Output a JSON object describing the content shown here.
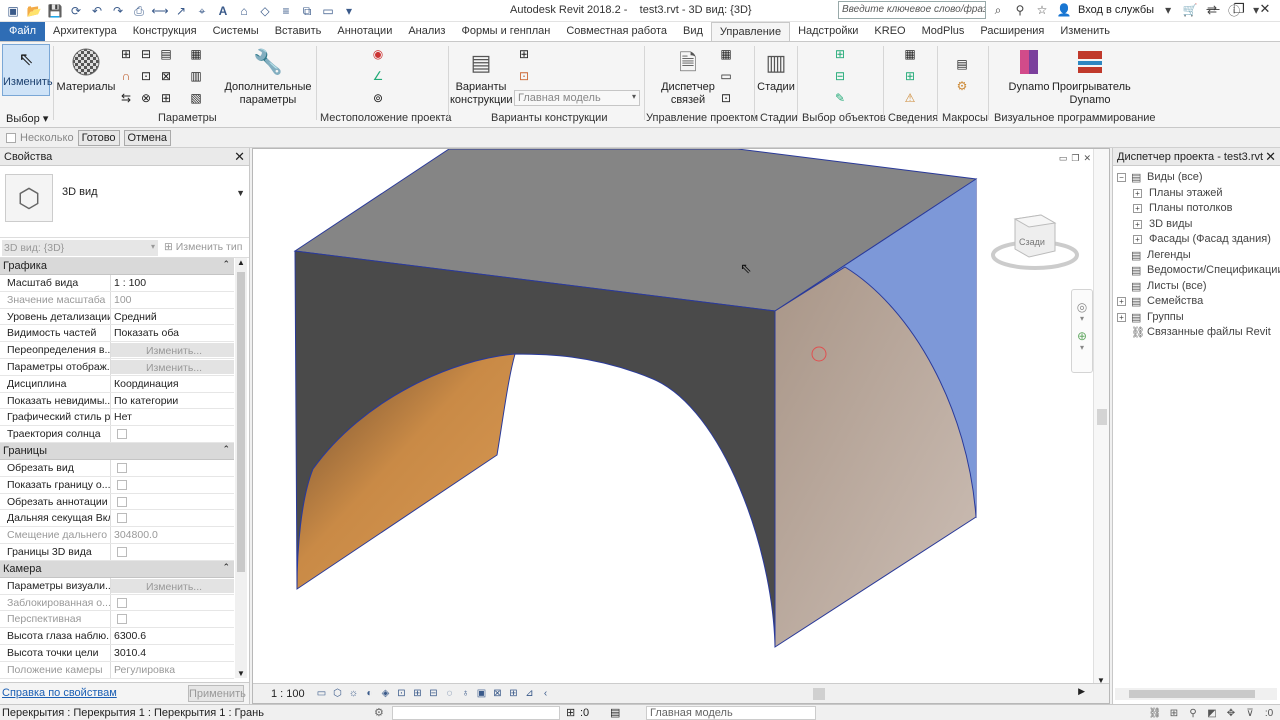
{
  "titlebar": {
    "app_title": "Autodesk Revit 2018.2 -",
    "doc_title": "test3.rvt - 3D вид: {3D}",
    "search_placeholder": "Введите ключевое слово/фразу",
    "signin": "Вход в службы"
  },
  "tabs": [
    "Файл",
    "Архитектура",
    "Конструкция",
    "Системы",
    "Вставить",
    "Аннотации",
    "Анализ",
    "Формы и генплан",
    "Совместная работа",
    "Вид",
    "Управление",
    "Надстройки",
    "KREO",
    "ModPlus",
    "Расширения",
    "Изменить"
  ],
  "active_tab_index": 10,
  "ribbon": {
    "modify_label": "Изменить",
    "select_label": "Выбор",
    "materials_label": "Материалы",
    "extra_params_line1": "Дополнительные",
    "extra_params_line2": "параметры",
    "params_group": "Параметры",
    "location_group": "Местоположение проекта",
    "variants_line1": "Варианты",
    "variants_line2": "конструкции",
    "variants_dropdown": "Главная модель",
    "variants_group": "Варианты конструкции",
    "links_mgr_line1": "Диспетчер",
    "links_mgr_line2": "связей",
    "manage_group": "Управление проектом",
    "phases_label": "Стадии",
    "phases_group": "Стадии",
    "selection_group": "Выбор объектов",
    "inquiry_group": "Сведения",
    "macros_group": "Макросы",
    "dynamo_label": "Dynamo",
    "dynamo_player_line1": "Проигрыватель",
    "dynamo_player_line2": "Dynamo",
    "visual_group": "Визуальное программирование"
  },
  "optbar": {
    "multiple_label": "Несколько",
    "finish_label": "Готово",
    "cancel_label": "Отмена"
  },
  "properties": {
    "title": "Свойства",
    "type_name": "3D вид",
    "instance_selector": "3D вид: {3D}",
    "edit_type": "Изменить тип",
    "groups": [
      {
        "name": "Графика",
        "rows": [
          {
            "name": "Масштаб вида",
            "value": "1 : 100",
            "dim": false
          },
          {
            "name": "Значение масштаба",
            "value": "100",
            "dim": true
          },
          {
            "name": "Уровень детализации",
            "value": "Средний",
            "dim": false
          },
          {
            "name": "Видимость частей",
            "value": "Показать оба",
            "dim": false
          },
          {
            "name": "Переопределения в...",
            "value": "Изменить...",
            "dim": false,
            "button": true
          },
          {
            "name": "Параметры отображ...",
            "value": "Изменить...",
            "dim": false,
            "button": true
          },
          {
            "name": "Дисциплина",
            "value": "Координация",
            "dim": false
          },
          {
            "name": "Показать невидимы...",
            "value": "По категории",
            "dim": false
          },
          {
            "name": "Графический стиль р...",
            "value": "Нет",
            "dim": false
          },
          {
            "name": "Траектория солнца",
            "value": "",
            "dim": false,
            "checkbox": true
          }
        ]
      },
      {
        "name": "Границы",
        "rows": [
          {
            "name": "Обрезать вид",
            "value": "",
            "dim": false,
            "checkbox": true
          },
          {
            "name": "Показать границу о...",
            "value": "",
            "dim": false,
            "checkbox": true
          },
          {
            "name": "Обрезать аннотации",
            "value": "",
            "dim": false,
            "checkbox": true
          },
          {
            "name": "Дальняя секущая Вкл",
            "value": "",
            "dim": false,
            "checkbox": true
          },
          {
            "name": "Смещение дальнего ...",
            "value": "304800.0",
            "dim": true
          },
          {
            "name": "Границы 3D вида",
            "value": "",
            "dim": false,
            "checkbox": true
          }
        ]
      },
      {
        "name": "Камера",
        "rows": [
          {
            "name": "Параметры визуали...",
            "value": "Изменить...",
            "dim": false,
            "button": true
          },
          {
            "name": "Заблокированная о...",
            "value": "",
            "dim": true,
            "checkbox": true
          },
          {
            "name": "Перспективная",
            "value": "",
            "dim": true,
            "checkbox": true
          },
          {
            "name": "Высота глаза наблю...",
            "value": "6300.6",
            "dim": false
          },
          {
            "name": "Высота точки цели",
            "value": "3010.4",
            "dim": false
          },
          {
            "name": "Положение камеры",
            "value": "Регулировка",
            "dim": true
          }
        ]
      }
    ],
    "help_link": "Справка по свойствам",
    "apply_button": "Применить"
  },
  "viewport": {
    "viewcube_label": "Сзади",
    "scale": "1 : 100"
  },
  "browser": {
    "title": "Диспетчер проекта - test3.rvt",
    "nodes": [
      {
        "label": "Виды (все)",
        "level": 0,
        "pm": "−"
      },
      {
        "label": "Планы этажей",
        "level": 1,
        "pm": "+"
      },
      {
        "label": "Планы потолков",
        "level": 1,
        "pm": "+"
      },
      {
        "label": "3D виды",
        "level": 1,
        "pm": "+"
      },
      {
        "label": "Фасады (Фасад здания)",
        "level": 1,
        "pm": "+"
      },
      {
        "label": "Легенды",
        "level": 0,
        "pm": ""
      },
      {
        "label": "Ведомости/Спецификации (в",
        "level": 0,
        "pm": ""
      },
      {
        "label": "Листы (все)",
        "level": 0,
        "pm": ""
      },
      {
        "label": "Семейства",
        "level": 0,
        "pm": "+"
      },
      {
        "label": "Группы",
        "level": 0,
        "pm": "+"
      },
      {
        "label": "Связанные файлы Revit",
        "level": 0,
        "pm": ""
      }
    ]
  },
  "statusbar": {
    "status_text": "Перекрытия : Перекрытия 1 : Перекрытия 1 : Грань",
    "zero": ":0",
    "model": "Главная модель"
  },
  "colors": {
    "file_tab": "#2f6db5",
    "top_face": "#858585",
    "front_face": "#4a4a4a",
    "side_face": "#b9aca3",
    "blue_face": "#7d98d8",
    "arch_orange": "#c98a46"
  }
}
